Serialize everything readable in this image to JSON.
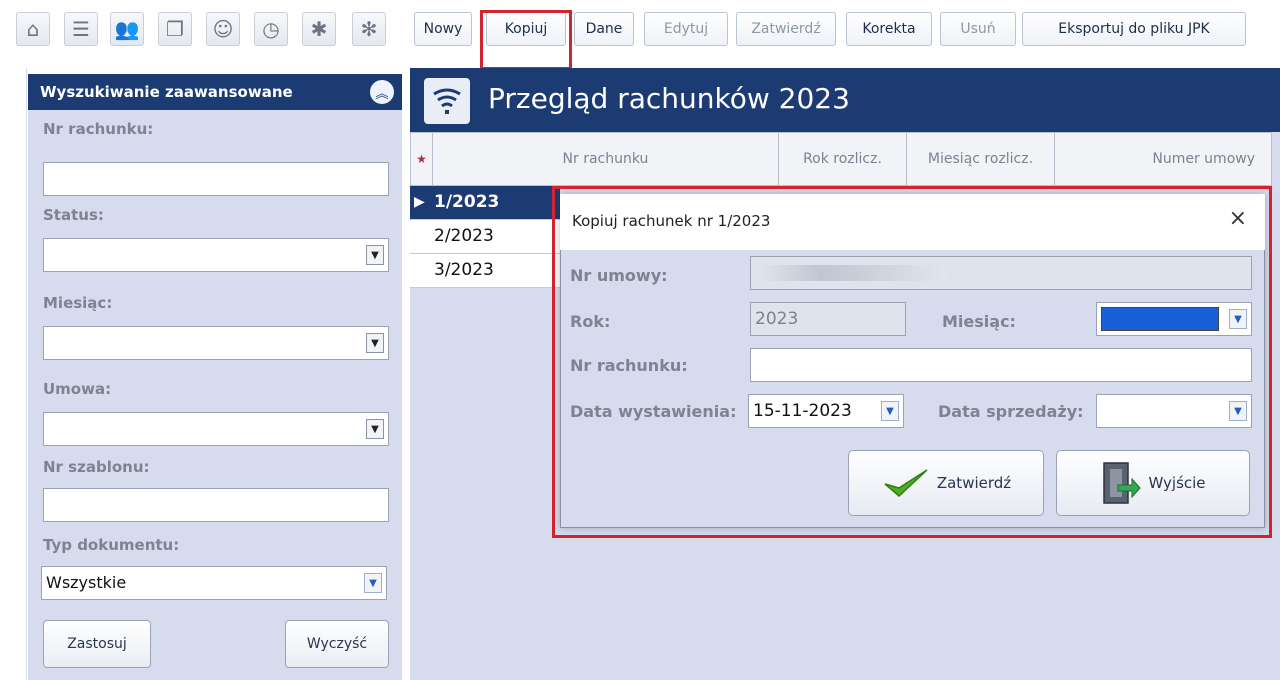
{
  "toolbar": {
    "icons": [
      "home-icon",
      "list-icon",
      "users-icon",
      "documents-icon",
      "contacts-icon",
      "clock-icon",
      "settings-icon",
      "gear-icon"
    ],
    "buttons": [
      {
        "label": "Nowy"
      },
      {
        "label": "Kopiuj"
      },
      {
        "label": "Dane"
      },
      {
        "label": "Edytuj"
      },
      {
        "label": "Zatwierdź"
      },
      {
        "label": "Korekta"
      },
      {
        "label": "Usuń"
      },
      {
        "label": "Eksportuj do pliku JPK"
      }
    ]
  },
  "search": {
    "title": "Wyszukiwanie zaawansowane",
    "fields": {
      "nr_rachunku": "Nr rachunku:",
      "status": "Status:",
      "miesiac": "Miesiąc:",
      "umowa": "Umowa:",
      "nr_szablonu": "Nr szablonu:",
      "typ_dokumentu": "Typ dokumentu:"
    },
    "typ_value": "Wszystkie",
    "apply": "Zastosuj",
    "clear": "Wyczyść"
  },
  "main": {
    "title": "Przegląd rachunków 2023",
    "columns": [
      "Nr rachunku",
      "Rok rozlicz.",
      "Miesiąc rozlicz.",
      "Numer umowy"
    ],
    "rows": [
      "1/2023",
      "2/2023",
      "3/2023"
    ]
  },
  "dialog": {
    "title": "Kopiuj rachunek nr 1/2023",
    "close": "×",
    "nr_umowy_label": "Nr umowy:",
    "rok_label": "Rok:",
    "rok_value": "2023",
    "miesiac_label": "Miesiąc:",
    "nr_rachunku_label": "Nr rachunku:",
    "data_wyst_label": "Data wystawienia:",
    "data_wyst_value": "15-11-2023",
    "data_sprz_label": "Data sprzedaży:",
    "confirm": "Zatwierdź",
    "exit": "Wyjście"
  },
  "colors": {
    "navy": "#1c3b73",
    "panel": "#d6dbee",
    "highlight": "#d42330",
    "selection": "#1760d8"
  }
}
